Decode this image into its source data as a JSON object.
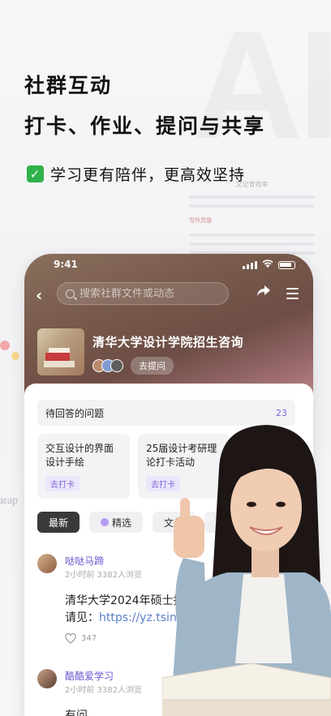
{
  "headline": {
    "line1": "社群互动",
    "line2": "打卡、作业、提问与共享",
    "subtitle": "学习更有陪伴，更高效坚持",
    "check_icon": "check-icon"
  },
  "background": {
    "watermark": "AI",
    "doc_title": "文记育效率",
    "doc_tag": "写作灵感",
    "left_fragment": "arap"
  },
  "status_bar": {
    "time": "9:41"
  },
  "nav": {
    "search_placeholder": "搜索社群文件或动态",
    "back_icon": "back-icon",
    "share_icon": "share-icon",
    "menu_icon": "menu-icon"
  },
  "group": {
    "name": "清华大学设计学院招生咨询",
    "ask_label": "去提问"
  },
  "questions": {
    "title": "待回答的问题",
    "count": "23",
    "cards": [
      {
        "title": "交互设计的界面设计手绘",
        "action": "去打卡"
      },
      {
        "title": "25届设计考研理论打卡活动",
        "action": "去打卡"
      }
    ]
  },
  "tabs": [
    {
      "label": "最新",
      "active": true
    },
    {
      "label": "精选",
      "active": false
    },
    {
      "label": "文件",
      "active": false
    },
    {
      "label": "打卡",
      "active": false
    }
  ],
  "posts": [
    {
      "author": "哒哒马蹄",
      "meta": "2小时前   3382人浏览",
      "text": "清华大学2024年硕士招生",
      "text2_prefix": "请见：",
      "link": "https://yz.tsinghua",
      "likes": "347"
    },
    {
      "author": "酷酷爱学习",
      "meta": "2小时前   3382人浏览",
      "text": "有问"
    }
  ],
  "colors": {
    "accent": "#7b63d9",
    "check": "#2fb14c",
    "header_gradient_start": "#8a6f5d",
    "header_gradient_end": "#c18d8b"
  }
}
